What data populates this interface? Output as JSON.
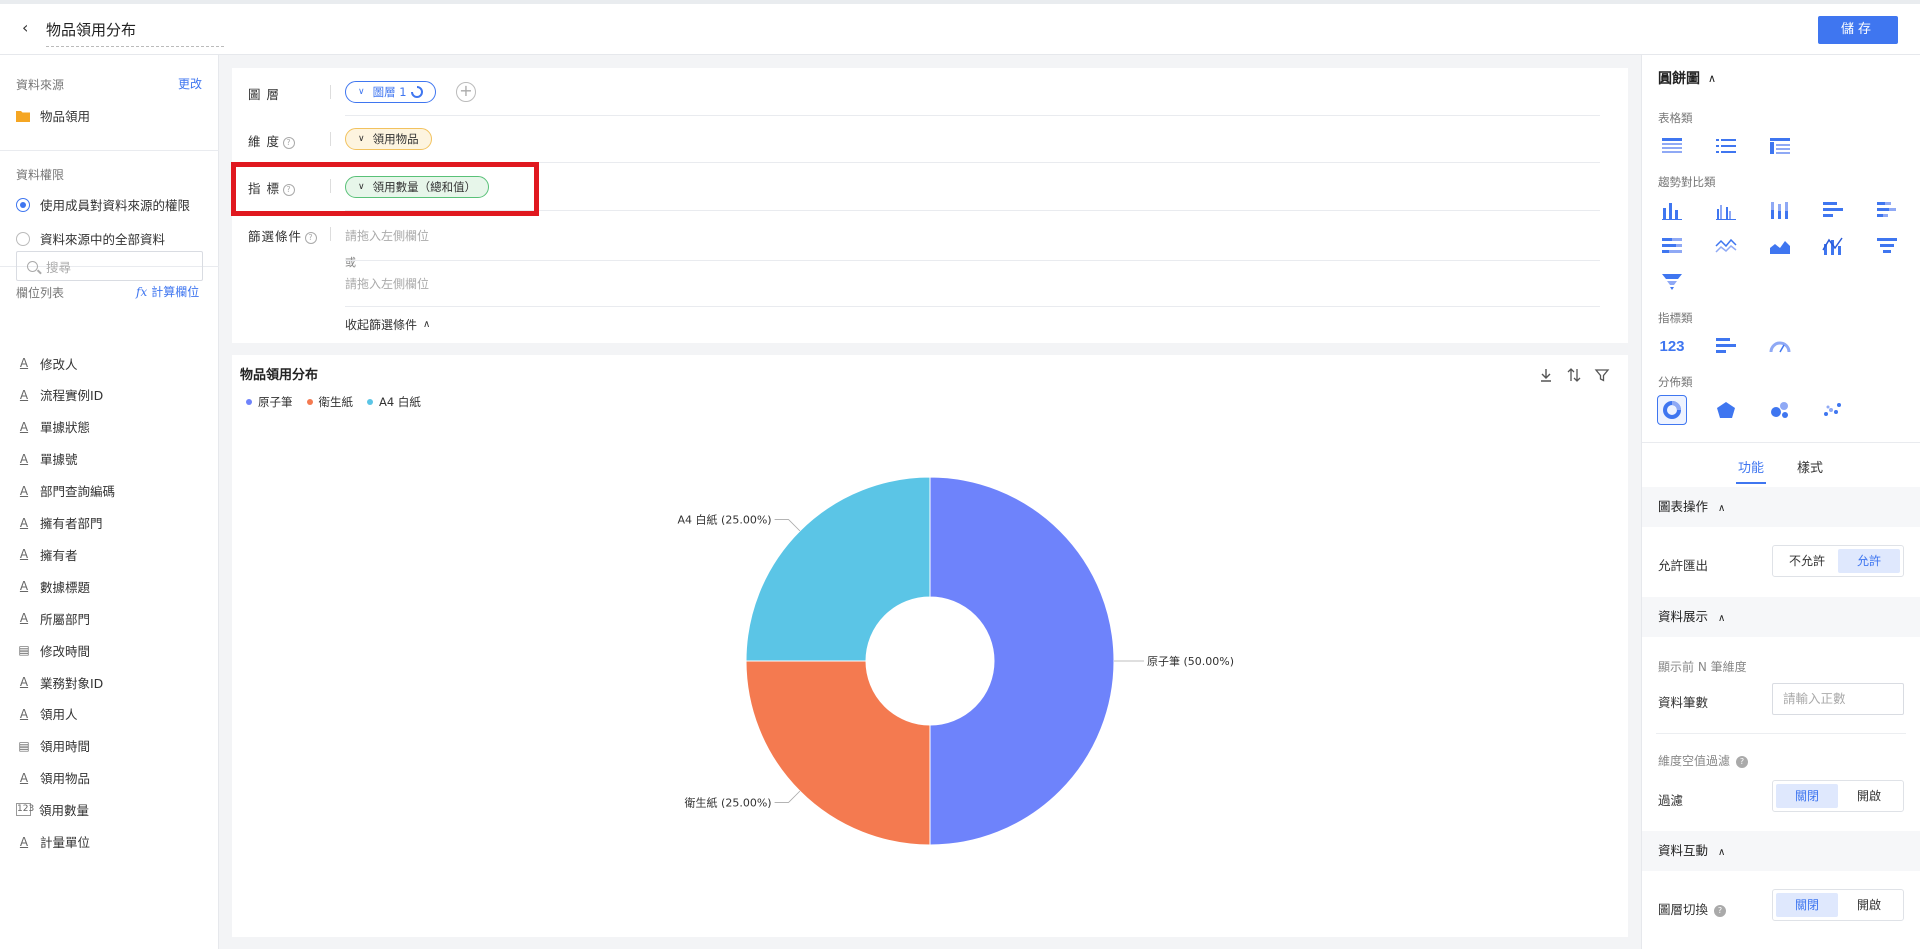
{
  "header": {
    "back_glyph": "‹",
    "title": "物品領用分布",
    "save_label": "儲存"
  },
  "left_panel": {
    "data_source_label": "資料來源",
    "change_link": "更改",
    "data_source_name": "物品領用",
    "permission_label": "資料權限",
    "permission_options": [
      {
        "label": "使用成員對資料來源的權限",
        "selected": true
      },
      {
        "label": "資料來源中的全部資料",
        "selected": false
      }
    ],
    "field_list_label": "欄位列表",
    "calc_field_link": "計算欄位",
    "search_placeholder": "搜尋",
    "fields": [
      {
        "type": "text",
        "label": "修改人"
      },
      {
        "type": "text",
        "label": "流程實例ID"
      },
      {
        "type": "text",
        "label": "單據狀態"
      },
      {
        "type": "text",
        "label": "單據號"
      },
      {
        "type": "text",
        "label": "部門查詢編碼"
      },
      {
        "type": "text",
        "label": "擁有者部門"
      },
      {
        "type": "text",
        "label": "擁有者"
      },
      {
        "type": "text",
        "label": "數據標題"
      },
      {
        "type": "text",
        "label": "所屬部門"
      },
      {
        "type": "date",
        "label": "修改時間"
      },
      {
        "type": "text",
        "label": "業務對象ID"
      },
      {
        "type": "text",
        "label": "領用人"
      },
      {
        "type": "date",
        "label": "領用時間"
      },
      {
        "type": "text",
        "label": "領用物品"
      },
      {
        "type": "number",
        "label": "領用數量"
      },
      {
        "type": "text",
        "label": "計量單位"
      }
    ]
  },
  "config": {
    "layer_label": "圖 層",
    "layer_pill": "圖層 1",
    "dimension_label": "維 度",
    "dimension_pill": "領用物品",
    "metric_label": "指 標",
    "metric_pill": "領用數量（總和值）",
    "filter_label": "篩選條件",
    "filter_placeholder_1": "請拖入左側欄位",
    "or_text": "或",
    "filter_placeholder_2": "請拖入左側欄位",
    "collapse_label": "收起篩選條件"
  },
  "chart_data": {
    "type": "pie",
    "title": "物品領用分布",
    "categories": [
      "原子筆",
      "衛生紙",
      "A4 白紙"
    ],
    "values": [
      50.0,
      25.0,
      25.0
    ],
    "colors": [
      "#6e83fb",
      "#f47a50",
      "#5bc5e6"
    ],
    "data_labels": [
      "原子筆 (50.00%)",
      "衛生紙 (25.00%)",
      "A4 白紙 (25.00%)"
    ],
    "legend_position": "top-left",
    "donut": true
  },
  "right_panel": {
    "chart_type_title": "圓餅圖",
    "categories": {
      "table": "表格類",
      "trend": "趨勢對比類",
      "indicator": "指標類",
      "distribution": "分佈類"
    },
    "tabs": [
      "功能",
      "樣式"
    ],
    "chart_ops_title": "圖表操作",
    "allow_export_label": "允許匯出",
    "export_options": [
      "不允許",
      "允許"
    ],
    "data_display_title": "資料展示",
    "top_n_label": "顯示前 N 筆維度",
    "row_count_label": "資料筆數",
    "row_count_placeholder": "請輸入正數",
    "null_filter_label": "維度空值過濾",
    "filter_label": "過濾",
    "toggle_options": [
      "關閉",
      "開啟"
    ],
    "interaction_title": "資料互動",
    "layer_switch_label": "圖層切換"
  }
}
